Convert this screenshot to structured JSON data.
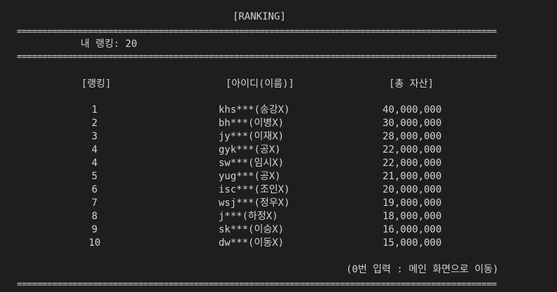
{
  "title": "[RANKING]",
  "separator": "===============================================================================================",
  "my_rank_text": "내 랭킹: 20",
  "headers": {
    "rank": "[랭킹]",
    "id": "[아이디(이름)]",
    "asset": "[총 자산]"
  },
  "rows": [
    {
      "rank": "1",
      "id": "khs***(송강X)",
      "asset": "40,000,000"
    },
    {
      "rank": "2",
      "id": "bh***(이병X)",
      "asset": "30,000,000"
    },
    {
      "rank": "3",
      "id": "jy***(이재X)",
      "asset": "28,000,000"
    },
    {
      "rank": "4",
      "id": "gyk***(공X)",
      "asset": "22,000,000"
    },
    {
      "rank": "4",
      "id": "sw***(임시X)",
      "asset": "22,000,000"
    },
    {
      "rank": "5",
      "id": "yug***(공X)",
      "asset": "21,000,000"
    },
    {
      "rank": "6",
      "id": "isc***(조인X)",
      "asset": "20,000,000"
    },
    {
      "rank": "7",
      "id": "wsj***(정우X)",
      "asset": "19,000,000"
    },
    {
      "rank": "8",
      "id": "j***(하정X)",
      "asset": "18,000,000"
    },
    {
      "rank": "9",
      "id": "sk***(이승X)",
      "asset": "16,000,000"
    },
    {
      "rank": "10",
      "id": "dw***(이동X)",
      "asset": "15,000,000"
    }
  ],
  "hint": "(0번 입력 : 메인 화면으로 이동)"
}
